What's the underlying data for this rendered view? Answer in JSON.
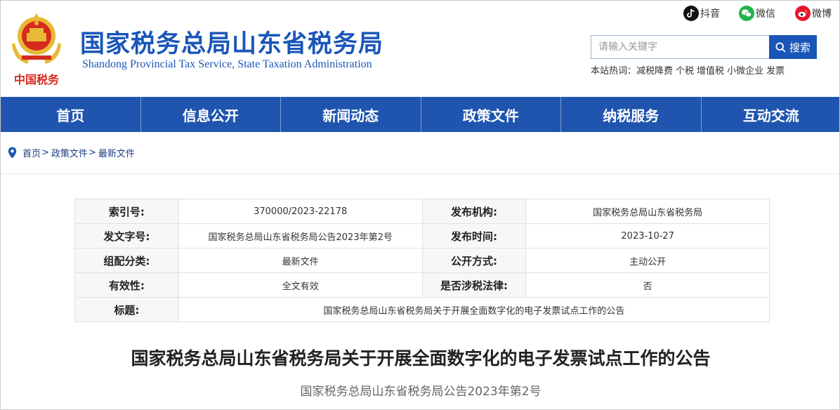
{
  "site": {
    "title": "国家税务总局山东省税务局",
    "subtitle": "Shandong Provincial Tax Service, State Taxation Administration",
    "logo_text": "中国税务"
  },
  "social": {
    "douyin": "抖音",
    "weixin": "微信",
    "weibo": "微博"
  },
  "search": {
    "placeholder": "请输入关键字",
    "button": "搜索",
    "hot_label": "本站热词：",
    "hot_words": [
      "减税降费",
      "个税",
      "增值税",
      "小微企业",
      "发票"
    ]
  },
  "nav": {
    "items": [
      "首页",
      "信息公开",
      "新闻动态",
      "政策文件",
      "纳税服务",
      "互动交流"
    ]
  },
  "breadcrumb": {
    "items": [
      "首页",
      "政策文件",
      "最新文件"
    ],
    "separator": ">"
  },
  "info": {
    "index_no_label": "索引号:",
    "index_no": "370000/2023-22178",
    "publisher_label": "发布机构:",
    "publisher": "国家税务总局山东省税务局",
    "doc_no_label": "发文字号:",
    "doc_no": "国家税务总局山东省税务局公告2023年第2号",
    "pub_time_label": "发布时间:",
    "pub_time": "2023-10-27",
    "category_label": "组配分类:",
    "category": "最新文件",
    "disclosure_label": "公开方式:",
    "disclosure": "主动公开",
    "validity_label": "有效性:",
    "validity": "全文有效",
    "tax_law_label": "是否涉税法律:",
    "tax_law": "否",
    "title_label": "标题:",
    "title": "国家税务总局山东省税务局关于开展全面数字化的电子发票试点工作的公告"
  },
  "article": {
    "title": "国家税务总局山东省税务局关于开展全面数字化的电子发票试点工作的公告",
    "doc_number": "国家税务总局山东省税务局公告2023年第2号"
  },
  "colors": {
    "brand_blue": "#1a56b8",
    "nav_bg": "#1f55ae",
    "emblem_red": "#d62a1e",
    "emblem_gold": "#e8b934"
  }
}
